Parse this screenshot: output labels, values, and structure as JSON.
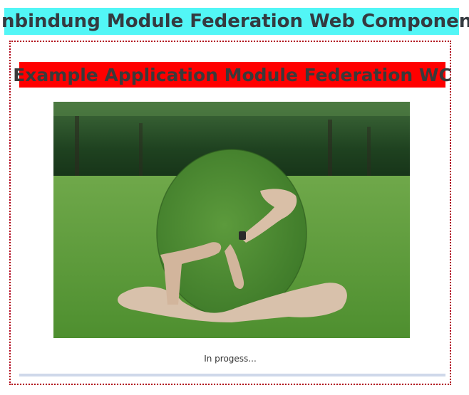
{
  "host": {
    "title": "Einbindung Module Federation Web Component"
  },
  "remote": {
    "title": "Example Application Module Federation WC",
    "status_text": "In progess...",
    "progress": 0.0
  },
  "colors": {
    "host_title_bg": "#52f6f6",
    "remote_title_bg": "#ff0000",
    "frame_border": "#b1001a"
  }
}
